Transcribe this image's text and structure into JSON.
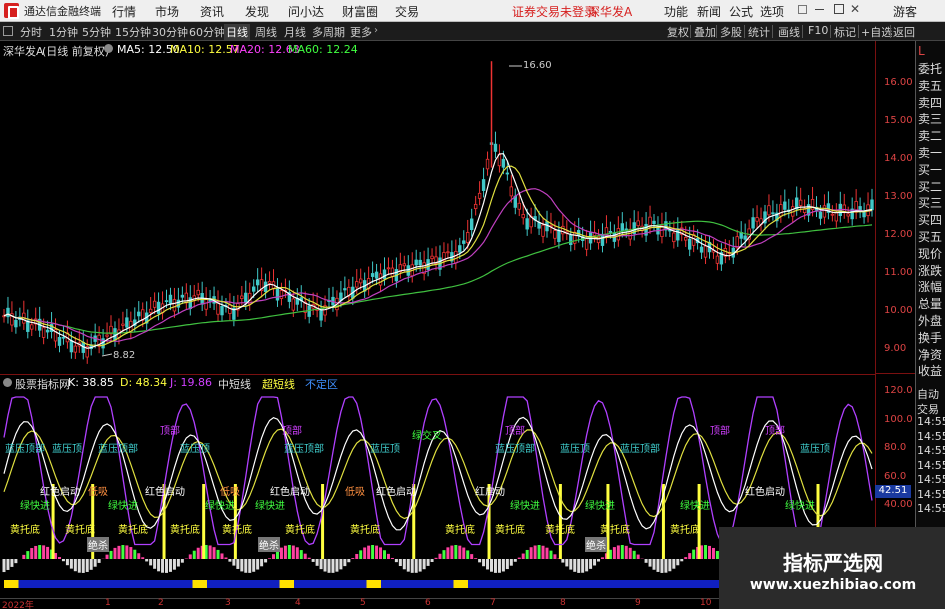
{
  "titlebar": {
    "app_name": "通达信金融终端",
    "menu": [
      "行情",
      "市场",
      "资讯",
      "发现",
      "问小达",
      "财富圈",
      "交易"
    ],
    "notice": "证券交易未登录",
    "stock": "深华发A",
    "right_menu": [
      "功能",
      "新闻",
      "公式",
      "选项"
    ],
    "guest": "游客"
  },
  "timeframes": [
    "分时",
    "1分钟",
    "5分钟",
    "15分钟",
    "30分钟",
    "60分钟",
    "日线",
    "周线",
    "月线",
    "多周期",
    "更多"
  ],
  "active_timeframe": "日线",
  "toolbar_right": [
    "复权",
    "叠加",
    "多股",
    "统计",
    "画线",
    "F10",
    "标记",
    "+自选",
    "返回"
  ],
  "info": {
    "name": "深华发A",
    "period": "(日线 前复权)",
    "ma5": "MA5: 12.50",
    "ma10": "MA10: 12.57",
    "ma20": "MA20: 12.63",
    "ma60": "MA60: 12.24"
  },
  "price_axis": [
    "16.00",
    "15.00",
    "14.00",
    "13.00",
    "12.00",
    "11.00",
    "10.00",
    "9.00"
  ],
  "annotations": {
    "high": "16.60",
    "low": "8.82"
  },
  "indicator": {
    "name": "股票指标网",
    "k": "K: 38.85",
    "d": "D: 48.34",
    "j": "J: 19.86",
    "line1": "中短线",
    "line2": "超短线",
    "line3": "不定区"
  },
  "ind_axis": [
    "120.0",
    "100.0",
    "80.0",
    "60.0",
    "40.00"
  ],
  "current_value": "42.51",
  "side_labels": [
    "委托",
    "卖五",
    "卖四",
    "卖三",
    "卖二",
    "卖一",
    "买一",
    "买二",
    "买三",
    "买四",
    "买五",
    "现价",
    "涨跌",
    "涨幅",
    "总量",
    "外盘",
    "换手",
    "净资",
    "收益"
  ],
  "side_times": [
    "自动",
    "交易",
    "14:55",
    "14:55",
    "14:55",
    "14:55",
    "14:55",
    "14:55",
    "14:55"
  ],
  "side_L": "L",
  "bottom_axis": {
    "year": "2022年",
    "months": [
      "1",
      "2",
      "3",
      "4",
      "5",
      "6",
      "7",
      "8",
      "9",
      "10"
    ]
  },
  "signals": {
    "top_purple": "顶部",
    "cyan_top": "蓝压顶部",
    "blue_press": "蓝压顶",
    "red": "红色启动",
    "low": "低吸",
    "yellow": "黄托底",
    "green_quick": "绿快进",
    "kill": "绝杀",
    "red_start": "红启动",
    "green_cross": "绿交叉"
  },
  "watermark": {
    "title": "指标严选网",
    "url": "www.xuezhibiao.com"
  },
  "colors": {
    "bg": "#000000",
    "axis_red": "#d44444",
    "ma5": "#ffffff",
    "ma10": "#ffff00",
    "ma20": "#ff40ff",
    "ma60": "#40ff40",
    "cyan": "#40d0d0",
    "indicator_purple": "#b040ff"
  }
}
